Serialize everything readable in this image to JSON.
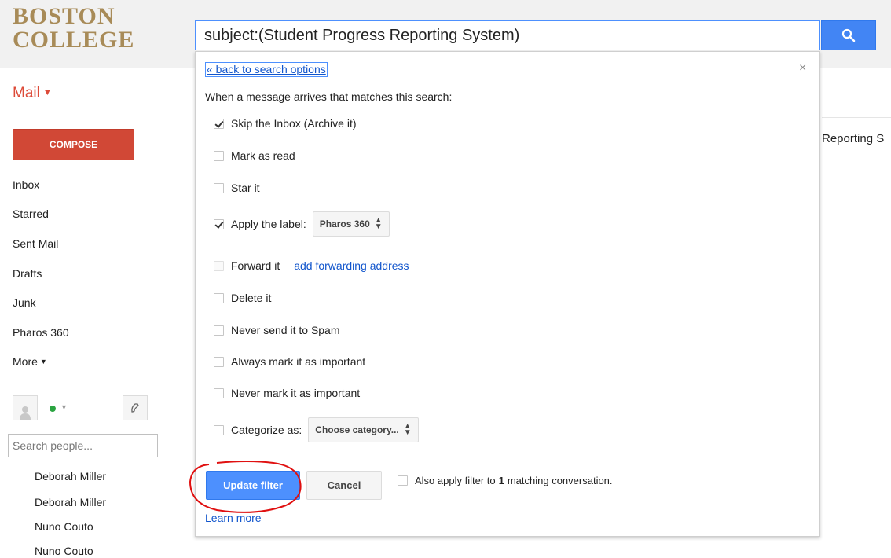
{
  "header": {
    "logo_line1": "BOSTON",
    "logo_line2": "COLLEGE",
    "search_value": "subject:(Student Progress Reporting System)",
    "search_button_icon": "search-icon"
  },
  "nav": {
    "mail_label": "Mail",
    "compose_label": "COMPOSE",
    "items": [
      "Inbox",
      "Starred",
      "Sent Mail",
      "Drafts",
      "Junk",
      "Pharos 360",
      "More"
    ],
    "people_search_placeholder": "Search people...",
    "contacts": [
      "Deborah Miller",
      "Deborah Miller",
      "Nuno Couto",
      "Nuno Couto"
    ]
  },
  "background": {
    "snippet": "Reporting S"
  },
  "filter_panel": {
    "back_link": "« back to search options",
    "close": "×",
    "intro": "When a message arrives that matches this search:",
    "options": [
      {
        "label": "Skip the Inbox (Archive it)",
        "checked": true
      },
      {
        "label": "Mark as read",
        "checked": false
      },
      {
        "label": "Star it",
        "checked": false
      },
      {
        "label": "Apply the label:",
        "checked": true,
        "select": "Pharos 360"
      },
      {
        "label": "Forward it",
        "checked": false,
        "disabled": true,
        "link": "add forwarding address"
      },
      {
        "label": "Delete it",
        "checked": false
      },
      {
        "label": "Never send it to Spam",
        "checked": false
      },
      {
        "label": "Always mark it as important",
        "checked": false
      },
      {
        "label": "Never mark it as important",
        "checked": false
      },
      {
        "label": "Categorize as:",
        "checked": false,
        "select": "Choose category..."
      }
    ],
    "update_button": "Update filter",
    "cancel_button": "Cancel",
    "also_apply_prefix": "Also apply filter to",
    "also_apply_count": "1",
    "also_apply_suffix": "matching conversation.",
    "learn_more": "Learn more"
  },
  "colors": {
    "logo": "#a88b58",
    "compose": "#d14836",
    "mail_label": "#dd4b39",
    "primary_button": "#4d90fe",
    "annotation_circle": "#e01010"
  }
}
